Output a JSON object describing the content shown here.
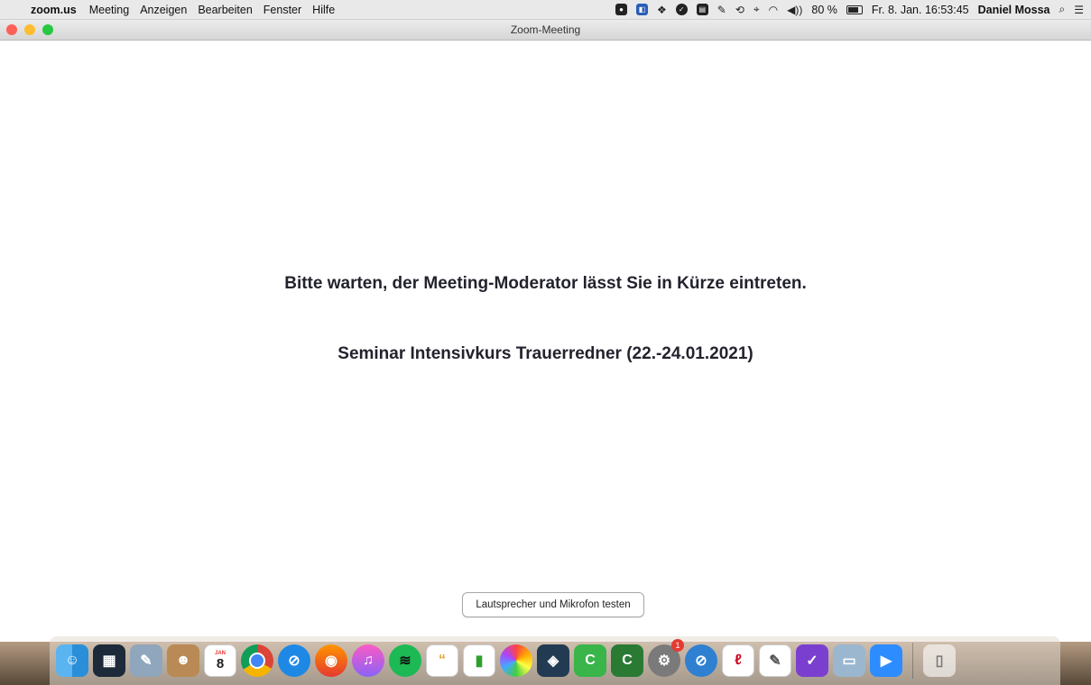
{
  "menubar": {
    "app_name": "zoom.us",
    "menus": [
      "Meeting",
      "Anzeigen",
      "Bearbeiten",
      "Fenster",
      "Hilfe"
    ],
    "volume": "◀))",
    "battery_percent": "80 %",
    "battery_level": 0.8,
    "clock": "Fr. 8. Jan. 16:53:45",
    "user": "Daniel Mossa"
  },
  "window": {
    "title": "Zoom-Meeting",
    "waiting_message": "Bitte warten, der Meeting-Moderator lässt Sie in Kürze eintreten.",
    "meeting_title": "Seminar Intensivkurs Trauerredner (22.-24.01.2021)",
    "test_button": "Lautsprecher und Mikrofon testen"
  },
  "dock": {
    "calendar_month": "JAN",
    "calendar_day": "8",
    "settings_badge": "1",
    "icons": [
      "finder-icon",
      "mission-control-icon",
      "preview-icon",
      "contacts-icon",
      "calendar-icon",
      "chrome-icon",
      "safari-icon",
      "firefox-icon",
      "itunes-icon",
      "spotify-icon",
      "quotes-icon",
      "numbers-icon",
      "photos-icon",
      "screen-tool-icon",
      "camtasia-icon",
      "camtasia-recorder-icon",
      "system-preferences-icon",
      "blocker-icon",
      "acrobat-icon",
      "textedit-icon",
      "omnifocus-icon",
      "image-capture-icon",
      "zoom-icon",
      "trash-icon"
    ]
  }
}
